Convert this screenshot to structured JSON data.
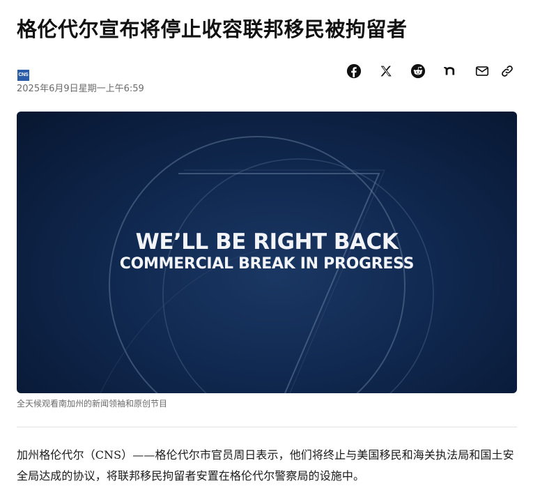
{
  "article": {
    "headline": "格伦代尔宣布将停止收容联邦移民被拘留者",
    "source_logo_text": "CNS",
    "publish_date": "2025年6月9日星期一上午6:59",
    "share_buttons": [
      {
        "name": "facebook",
        "icon": "facebook-icon"
      },
      {
        "name": "x",
        "icon": "x-icon"
      },
      {
        "name": "reddit",
        "icon": "reddit-icon"
      },
      {
        "name": "nextdoor",
        "icon": "nextdoor-icon"
      },
      {
        "name": "email",
        "icon": "mail-icon"
      },
      {
        "name": "copy-link",
        "icon": "link-icon"
      }
    ],
    "hero_image": {
      "title": "WE’LL BE RIGHT BACK",
      "subtitle": "COMMERCIAL BREAK IN PROGRESS",
      "background_color": "#0b1e3e"
    },
    "caption": "全天候观看南加州的新闻领袖和原创节目",
    "body_paragraph": "加州格伦代尔（CNS）——格伦代尔市官员周日表示，他们将终止与美国移民和海关执法局和国土安全局达成的协议，将联邦移民拘留者安置在格伦代尔警察局的设施中。"
  }
}
